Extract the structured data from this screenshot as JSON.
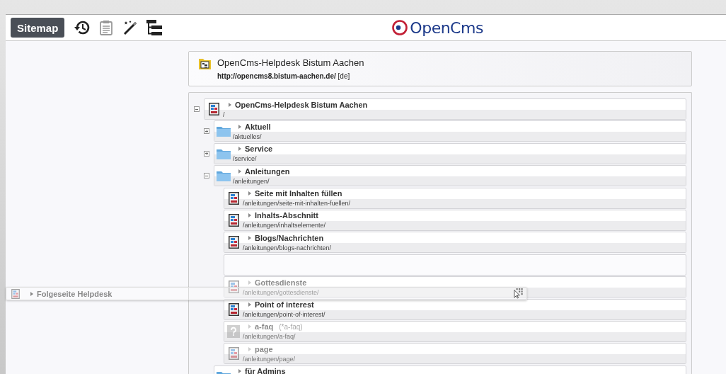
{
  "toolbar": {
    "mode_button": "Sitemap",
    "tools": [
      {
        "kind": "history",
        "disabled": false
      },
      {
        "kind": "clipboard",
        "disabled": true
      },
      {
        "kind": "wand",
        "disabled": false
      },
      {
        "kind": "tree",
        "disabled": false
      }
    ],
    "logo": "OpenCms"
  },
  "header": {
    "title": "OpenCms-Helpdesk Bistum Aachen",
    "url": "http://opencms8.bistum-aachen.de/",
    "locale": "[de]"
  },
  "tree": [
    {
      "kind": "page",
      "title": "OpenCms-Helpdesk Bistum Aachen",
      "path": "/",
      "dimmed": false,
      "expanded": true,
      "children": [
        {
          "kind": "folder",
          "title": "Aktuell",
          "path": "/aktuelles/",
          "dimmed": false,
          "expanded": false
        },
        {
          "kind": "folder",
          "title": "Service",
          "path": "/service/",
          "dimmed": false,
          "expanded": false
        },
        {
          "kind": "folder",
          "title": "Anleitungen",
          "path": "/anleitungen/",
          "dimmed": false,
          "expanded": true,
          "children": [
            {
              "kind": "page",
              "title": "Seite mit Inhalten füllen",
              "path": "/anleitungen/seite-mit-inhalten-fuellen/",
              "dimmed": false
            },
            {
              "kind": "page",
              "title": "Inhalts-Abschnitt",
              "path": "/anleitungen/inhaltselemente/",
              "dimmed": false
            },
            {
              "kind": "page",
              "title": "Blogs/Nachrichten",
              "path": "/anleitungen/blogs-nachrichten/",
              "dimmed": false
            },
            {
              "kind": "placeholder"
            },
            {
              "kind": "page",
              "title": "Gottesdienste",
              "path": "/anleitungen/gottesdienste/",
              "dimmed": true
            },
            {
              "kind": "page",
              "title": "Point of interest",
              "path": "/anleitungen/point-of-interest/",
              "dimmed": false
            },
            {
              "kind": "unknown",
              "title": "a-faq",
              "suffix": "(*a-faq)",
              "path": "/anleitungen/a-faq/",
              "dimmed": true
            },
            {
              "kind": "page",
              "title": "page",
              "path": "/anleitungen/page/",
              "dimmed": true
            }
          ]
        },
        {
          "kind": "folder",
          "title": "für Admins",
          "dimmed": false
        }
      ]
    }
  ],
  "drag_item": {
    "kind": "page",
    "title": "Folgeseite Helpdesk"
  }
}
